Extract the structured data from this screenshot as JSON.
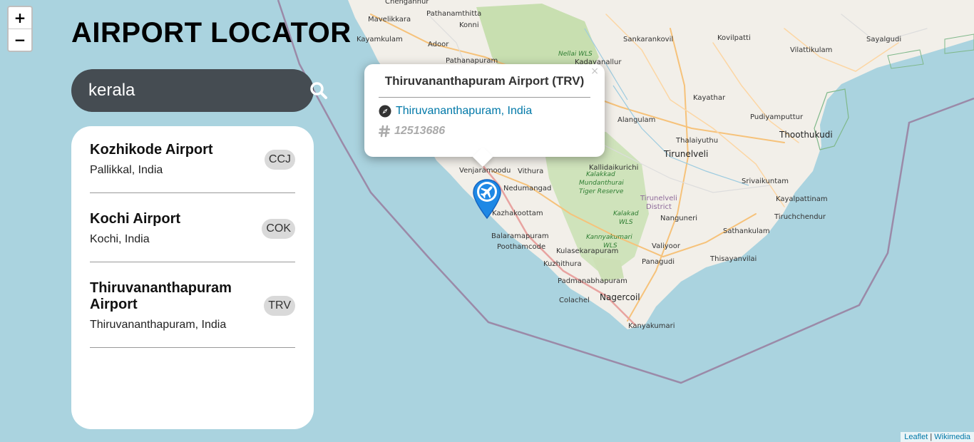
{
  "app": {
    "title": "AIRPORT LOCATOR"
  },
  "zoom": {
    "in_label": "+",
    "out_label": "−"
  },
  "search": {
    "value": "kerala",
    "icon": "search-icon"
  },
  "results": [
    {
      "name": "Kozhikode Airport",
      "location": "Pallikkal, India",
      "code": "CCJ"
    },
    {
      "name": "Kochi Airport",
      "location": "Kochi, India",
      "code": "COK"
    },
    {
      "name": "Thiruvananthapuram Airport",
      "location": "Thiruvananthapuram, India",
      "code": "TRV"
    }
  ],
  "popup": {
    "title": "Thiruvananthapuram Airport (TRV)",
    "location": "Thiruvananthapuram, India",
    "location_icon": "compass-icon",
    "id": "12513686",
    "id_icon": "hash-icon",
    "close": "×"
  },
  "marker": {
    "icon": "airplane-icon",
    "color": "#1e88e5"
  },
  "map": {
    "labels": {
      "chengannur": "Chengannur",
      "pathanamthitta": "Pathanamthitta",
      "mavelikkara": "Mavelikkara",
      "konni": "Konni",
      "kayamkulam": "Kayamkulam",
      "adoor": "Adoor",
      "pathanapuram": "Pathanapuram",
      "nellai_wls": "Nellai WLS",
      "kadayanallur": "Kadayanallur",
      "sankarankovil": "Sankarankovil",
      "kovilpatti": "Kovilpatti",
      "sayalgudi": "Sayalgudi",
      "vilattikulam": "Vilattikulam",
      "kayathar": "Kayathar",
      "alangulam": "Alangulam",
      "pudiyamputtur": "Pudiyamputtur",
      "thoothukudi": "Thoothukudi",
      "thalaiyuthu": "Thalaiyuthu",
      "tirunelveli": "Tirunelveli",
      "venjaramoodu": "Venjaramoodu",
      "vithura": "Vithura",
      "kallidaikurichi": "Kallidaikurichi",
      "kalakkad_wls": "Kalakkad Mundanthurai Tiger Reserve",
      "srivaikuntam": "Srivaikuntam",
      "tirunelveli_district": "Tirunelveli District",
      "kayalpattinam": "Kayalpattinam",
      "tiruchchendur": "Tiruchchendur",
      "nedumangad": "Nedumangad",
      "kazhakoottam": "Kazhakoottam",
      "kalakad_wls": "Kalakad WLS",
      "nanguneri": "Nanguneri",
      "sathankulam": "Sathankulam",
      "balaramapuram": "Balaramapuram",
      "kanyakumari_wls": "Kannyakumari WLS",
      "poothamcode": "Poothamcode",
      "valiyoor": "Valiyoor",
      "kulasekarapuram": "Kulasekarapuram",
      "kuzhithura": "Kuzhithura",
      "panagudi": "Panagudi",
      "thisayanvilai": "Thisayanvilai",
      "padmanabhapuram": "Padmanabhapuram",
      "nagercoil": "Nagercoil",
      "colachel": "Colachel",
      "kanyakumari": "Kanyakumari"
    }
  },
  "attribution": {
    "leaflet": "Leaflet",
    "separator": " | ",
    "wikimedia": "Wikimedia"
  },
  "colors": {
    "water": "#aad3df",
    "land": "#f2efe9",
    "search_bg": "#454c52",
    "link": "#0078a8",
    "code_badge": "#d9d9d9",
    "boundary": "#9b8aa8"
  }
}
